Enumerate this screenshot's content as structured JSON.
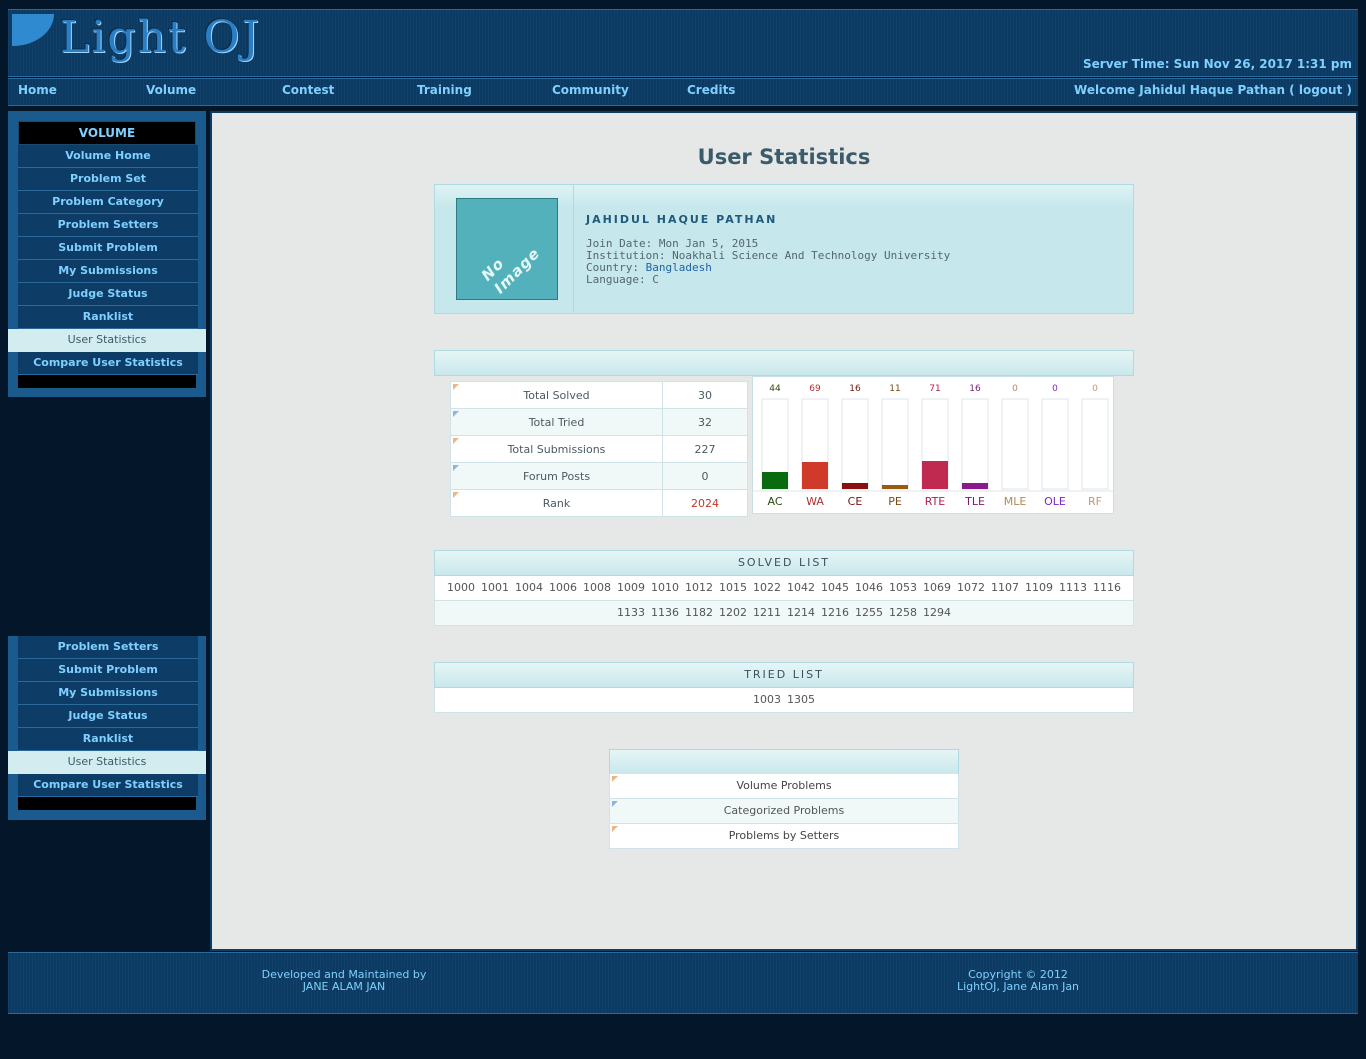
{
  "header": {
    "logo_text": "Light OJ",
    "server_time": "Server Time: Sun Nov 26, 2017 1:31 pm"
  },
  "nav": {
    "items": [
      "Home",
      "Volume",
      "Contest",
      "Training",
      "Community",
      "Credits"
    ],
    "welcome_prefix": "Welcome Jahidul Haque Pathan ( ",
    "logout": "logout",
    "welcome_suffix": " )"
  },
  "sidebar": {
    "title": "VOLUME",
    "items": [
      "Volume Home",
      "Problem Set",
      "Problem Category",
      "Problem Setters",
      "Submit Problem",
      "My Submissions",
      "Judge Status",
      "Ranklist",
      "User Statistics",
      "Compare User Statistics"
    ],
    "active": "User Statistics",
    "items2": [
      "Problem Setters",
      "Submit Problem",
      "My Submissions",
      "Judge Status",
      "Ranklist",
      "User Statistics",
      "Compare User Statistics"
    ]
  },
  "page": {
    "title": "User Statistics"
  },
  "profile": {
    "no_image": "No Image",
    "name": "JAHIDUL HAQUE PATHAN",
    "join_date": "Join Date: Mon Jan 5, 2015",
    "institution": "Institution: Noakhali Science And Technology University",
    "country_label": "Country: ",
    "country": "Bangladesh",
    "language": "Language: C"
  },
  "stats": [
    {
      "label": "Total Solved",
      "value": "30"
    },
    {
      "label": "Total Tried",
      "value": "32"
    },
    {
      "label": "Total Submissions",
      "value": "227"
    },
    {
      "label": "Forum Posts",
      "value": "0"
    },
    {
      "label": "Rank",
      "value": "2024"
    }
  ],
  "chart_data": {
    "type": "bar",
    "categories": [
      "AC",
      "WA",
      "CE",
      "PE",
      "RTE",
      "TLE",
      "MLE",
      "OLE",
      "RF"
    ],
    "values": [
      44,
      69,
      16,
      11,
      71,
      16,
      0,
      0,
      0
    ],
    "colors": [
      "#0a6a10",
      "#d03a2a",
      "#8a1010",
      "#9a5a10",
      "#c02a50",
      "#8a1a8a",
      "#b08a5a",
      "#7a2ac0",
      "#c09a6a"
    ],
    "label_colors": [
      "#2a4a10",
      "#b03030",
      "#7a1010",
      "#7a4a10",
      "#b02050",
      "#7a1a7a",
      "#b08a5a",
      "#7a2ac0",
      "#c09a6a"
    ],
    "ylim": [
      0,
      227
    ]
  },
  "solved": {
    "title": "SOLVED LIST",
    "row1": [
      "1000",
      "1001",
      "1004",
      "1006",
      "1008",
      "1009",
      "1010",
      "1012",
      "1015",
      "1022",
      "1042",
      "1045",
      "1046",
      "1053",
      "1069",
      "1072",
      "1107",
      "1109",
      "1113",
      "1116"
    ],
    "row2": [
      "1133",
      "1136",
      "1182",
      "1202",
      "1211",
      "1214",
      "1216",
      "1255",
      "1258",
      "1294"
    ]
  },
  "tried": {
    "title": "TRIED LIST",
    "items": [
      "1003",
      "1305"
    ]
  },
  "links": [
    "Volume Problems",
    "Categorized Problems",
    "Problems by Setters"
  ],
  "footer": {
    "left_line1": "Developed and Maintained by",
    "left_line2": "JANE ALAM JAN",
    "right_line1": "Copyright © 2012",
    "right_line2": "LightOJ, Jane Alam Jan"
  }
}
